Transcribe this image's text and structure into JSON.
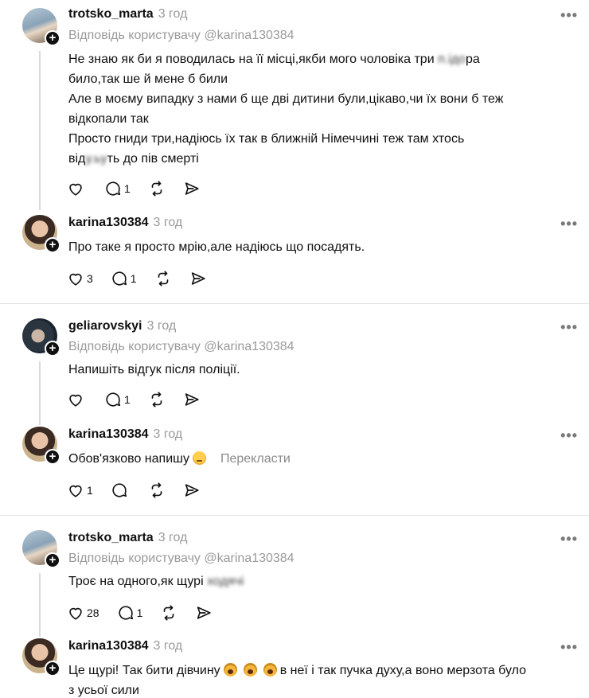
{
  "posts": [
    {
      "username": "trotsko_marta",
      "time": "3 год",
      "reply_to": "Відповідь користувачу @karina130384",
      "lines": [
        "Не знаю як би я поводилась на її місці,якби мого чоловіка три",
        "ра",
        "било,так ше й мене б били",
        "Але в моєму випадку з нами б ще дві дитини були,цікаво,чи їх вони б теж",
        "відкопали так",
        "Просто гниди три,надіюсь їх так в ближній Німеччині теж там хтось",
        "від",
        "ть до пів смерті"
      ],
      "likes": "",
      "comments": "1"
    },
    {
      "username": "karina130384",
      "time": "3 год",
      "text": "Про таке я просто мрію,але надіюсь що посадять.",
      "likes": "3",
      "comments": "1"
    },
    {
      "username": "geliarovskyi",
      "time": "3 год",
      "reply_to": "Відповідь користувачу @karina130384",
      "text": "Напишіть відгук після поліції.",
      "likes": "",
      "comments": "1"
    },
    {
      "username": "karina130384",
      "time": "3 год",
      "text": "Обов'язково напишу",
      "translate": "Перекласти",
      "likes": "1",
      "comments": ""
    },
    {
      "username": "trotsko_marta",
      "time": "3 год",
      "reply_to": "Відповідь користувачу @karina130384",
      "text": "Троє на одного,як щурі",
      "likes": "28",
      "comments": "1"
    },
    {
      "username": "karina130384",
      "time": "3 год",
      "text_a": "Це щурі! Так бити дівчину",
      "text_b": "в неї і так пучка духу,а воно мерзота було",
      "text_c": "з усьої сили"
    }
  ],
  "more_label": "•••",
  "icons": {
    "like": "heart-icon",
    "comment": "comment-icon",
    "repost": "repost-icon",
    "share": "share-icon",
    "follow": "plus-icon"
  }
}
